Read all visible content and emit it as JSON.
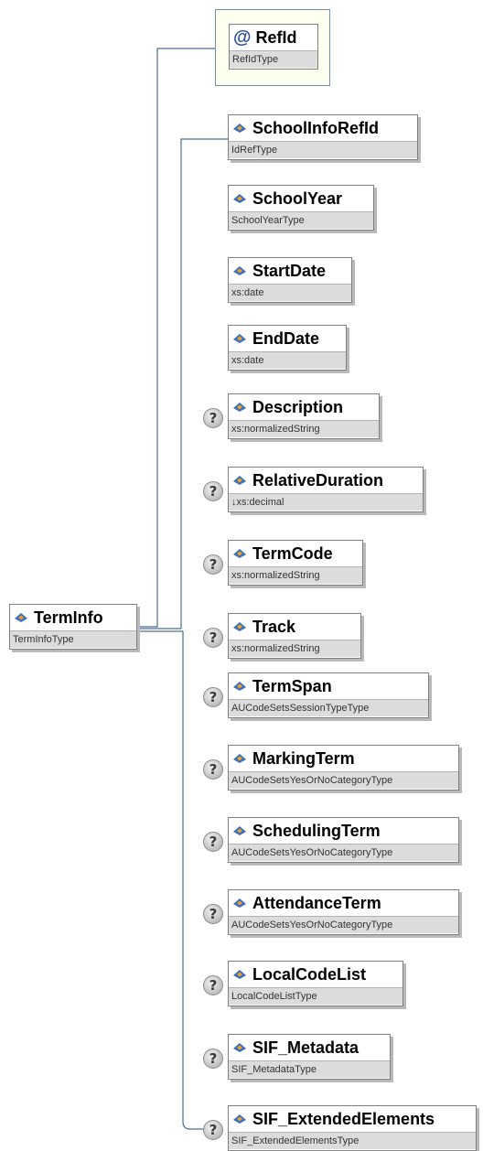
{
  "root": {
    "name": "TermInfo",
    "type": "TermInfoType"
  },
  "attribute": {
    "symbol": "@",
    "name": "RefId",
    "type": "RefIdType"
  },
  "optional_marker": "?",
  "elements": [
    {
      "name": "SchoolInfoRefId",
      "type": "IdRefType",
      "optional": false
    },
    {
      "name": "SchoolYear",
      "type": "SchoolYearType",
      "optional": false
    },
    {
      "name": "StartDate",
      "type": "xs:date",
      "optional": false
    },
    {
      "name": "EndDate",
      "type": "xs:date",
      "optional": false
    },
    {
      "name": "Description",
      "type": "xs:normalizedString",
      "optional": true
    },
    {
      "name": "RelativeDuration",
      "type": "↓xs:decimal",
      "optional": true
    },
    {
      "name": "TermCode",
      "type": "xs:normalizedString",
      "optional": true
    },
    {
      "name": "Track",
      "type": "xs:normalizedString",
      "optional": true
    },
    {
      "name": "TermSpan",
      "type": "AUCodeSetsSessionTypeType",
      "optional": true
    },
    {
      "name": "MarkingTerm",
      "type": "AUCodeSetsYesOrNoCategoryType",
      "optional": true
    },
    {
      "name": "SchedulingTerm",
      "type": "AUCodeSetsYesOrNoCategoryType",
      "optional": true
    },
    {
      "name": "AttendanceTerm",
      "type": "AUCodeSetsYesOrNoCategoryType",
      "optional": true
    },
    {
      "name": "LocalCodeList",
      "type": "LocalCodeListType",
      "optional": true
    },
    {
      "name": "SIF_Metadata",
      "type": "SIF_MetadataType",
      "optional": true
    },
    {
      "name": "SIF_ExtendedElements",
      "type": "SIF_ExtendedElementsType",
      "optional": true
    }
  ],
  "colors": {
    "connector": "#4b6f93",
    "icon_blue": "#3c6fc2",
    "icon_orange": "#f0a020"
  }
}
